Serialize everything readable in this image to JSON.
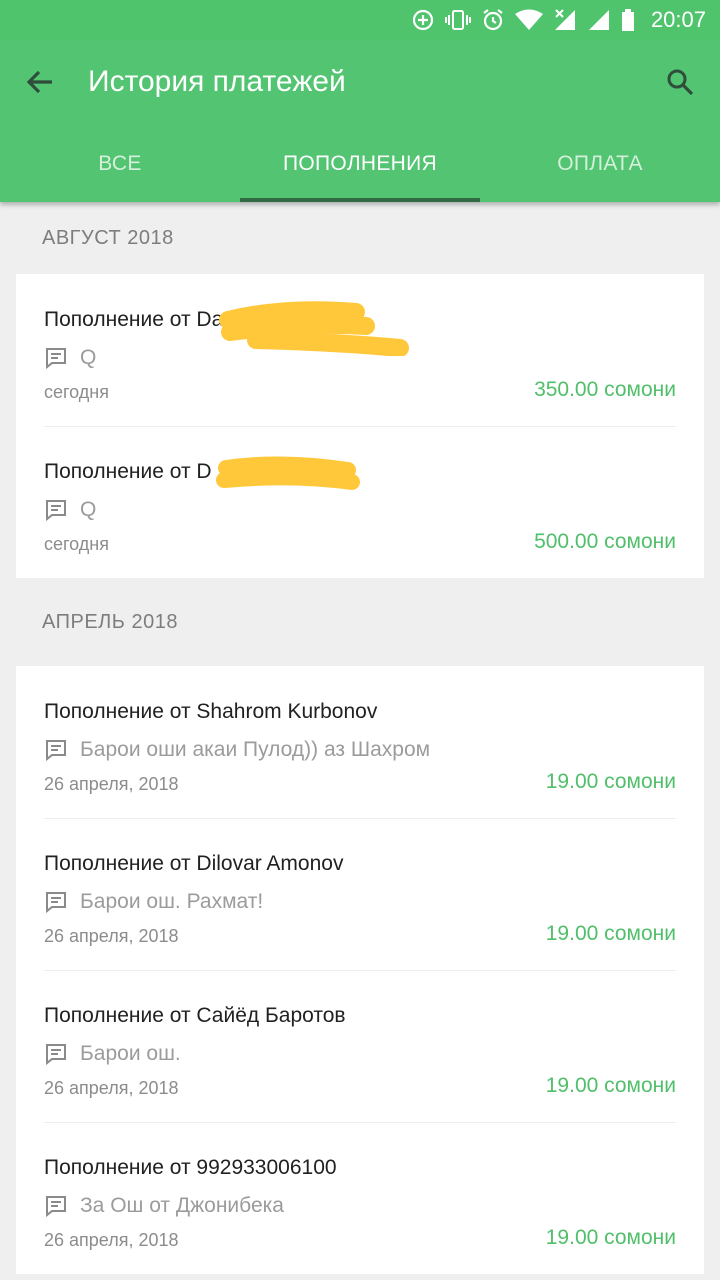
{
  "status_bar": {
    "time": "20:07"
  },
  "app_bar": {
    "title": "История платежей"
  },
  "tabs": [
    {
      "label": "ВСЕ",
      "active": false
    },
    {
      "label": "ПОПОЛНЕНИЯ",
      "active": true
    },
    {
      "label": "ОПЛАТА",
      "active": false
    }
  ],
  "sections": [
    {
      "header": "АВГУСТ 2018",
      "items": [
        {
          "name": "Пополнение от Da",
          "comment": "Q",
          "date": "сегодня",
          "amount": "350.00 сомони"
        },
        {
          "name": "Пополнение от D",
          "comment": "Q",
          "date": "сегодня",
          "amount": "500.00 сомони"
        }
      ]
    },
    {
      "header": "АПРЕЛЬ 2018",
      "items": [
        {
          "name": "Пополнение от Shahrom Kurbonov",
          "comment": "Барои оши акаи Пулод)) аз Шахром",
          "date": "26 апреля, 2018",
          "amount": "19.00 сомони"
        },
        {
          "name": "Пополнение от Dilovar Amonov",
          "comment": "Барои ош. Рахмат!",
          "date": "26 апреля, 2018",
          "amount": "19.00 сомони"
        },
        {
          "name": "Пополнение от Сайёд Баротов",
          "comment": "Барои ош.",
          "date": "26 апреля, 2018",
          "amount": "19.00 сомони"
        },
        {
          "name": "Пополнение от 992933006100",
          "comment": "За Ош от Джонибека",
          "date": "26 апреля, 2018",
          "amount": "19.00 сомони"
        }
      ]
    }
  ],
  "colors": {
    "primary": "#53c472",
    "amount": "#4fbf6a",
    "redaction": "#ffc83a"
  }
}
